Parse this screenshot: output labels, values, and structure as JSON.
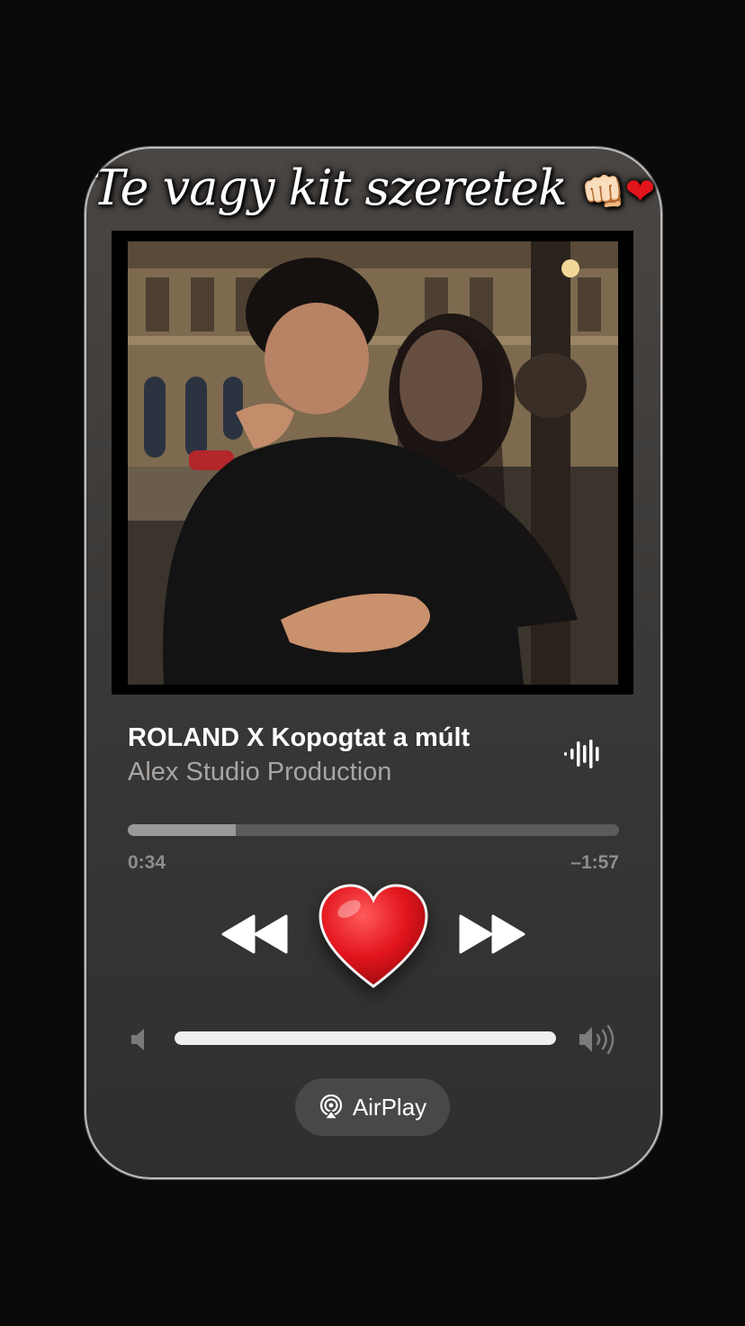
{
  "caption": {
    "text": "Te vagy kit szeretek",
    "emoji_fist": "👊🏻",
    "emoji_heart": "❤"
  },
  "track": {
    "title": "ROLAND X Kopogtat a múlt",
    "artist": "Alex Studio Production"
  },
  "playback": {
    "elapsed": "0:34",
    "remaining": "–1:57",
    "progress_fraction": 0.22
  },
  "volume": {
    "level_fraction": 1.0
  },
  "airplay": {
    "label": "AirPlay"
  },
  "icons": {
    "waveform": "waveform-icon",
    "rewind": "rewind-icon",
    "heart": "heart-icon",
    "forward": "fast-forward-icon",
    "volume_low": "speaker-low-icon",
    "volume_high": "speaker-high-icon",
    "airplay": "airplay-icon"
  },
  "colors": {
    "heart": "#e2141c",
    "progress_fill": "#9c9a99",
    "volume_fill": "#efeff1"
  }
}
